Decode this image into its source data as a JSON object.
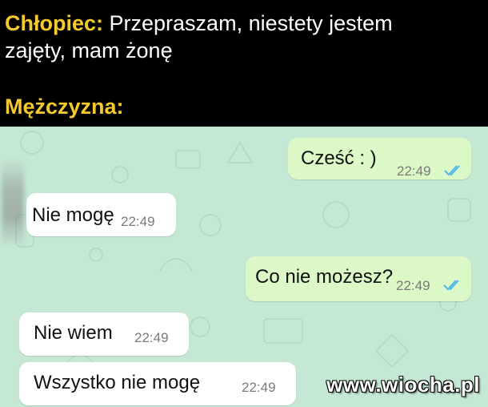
{
  "caption": {
    "line1_speaker": "Chłopiec:",
    "line1_text": " Przepraszam, niestety jestem",
    "line2_text": "zajęty, mam żonę",
    "line3_speaker": "Mężczyzna:"
  },
  "messages": [
    {
      "direction": "out",
      "text": "Cześć : )",
      "time": "22:49",
      "status": "read"
    },
    {
      "direction": "in",
      "text": "Nie mogę",
      "time": "22:49"
    },
    {
      "direction": "out",
      "text": "Co nie możesz?",
      "time": "22:49",
      "status": "read"
    },
    {
      "direction": "in",
      "text": "Nie wiem",
      "time": "22:49"
    },
    {
      "direction": "in",
      "text": "Wszystko nie mogę",
      "time": "22:49"
    }
  ],
  "watermark": "www.wiocha.pl",
  "colors": {
    "caption_bg": "#000000",
    "speaker": "#f5c92b",
    "chat_bg": "#c4e8d4",
    "outgoing_bubble": "#dcf8c6",
    "incoming_bubble": "#ffffff",
    "read_ticks": "#4fb6ec"
  }
}
